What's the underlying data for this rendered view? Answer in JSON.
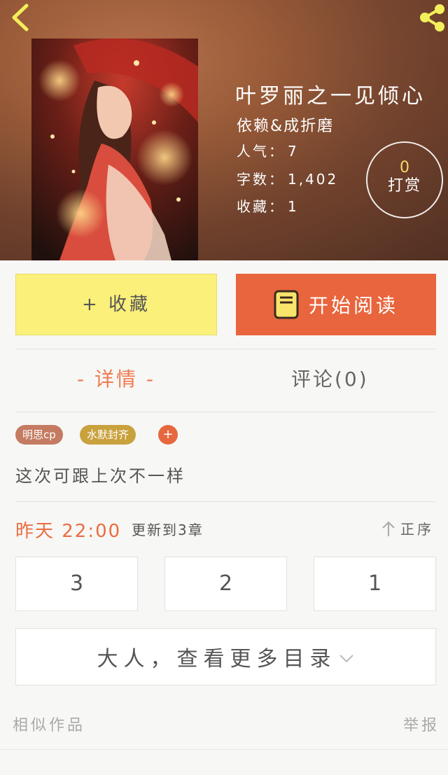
{
  "header": {
    "title": "叶罗丽之一见倾心",
    "author": "依赖&成折磨",
    "stats": [
      {
        "label": "人气：",
        "value": "7"
      },
      {
        "label": "字数：",
        "value": "1,402"
      },
      {
        "label": "收藏：",
        "value": "1"
      }
    ],
    "reward": {
      "count": "0",
      "label": "打赏"
    }
  },
  "actions": {
    "collect_label": "+ 收藏",
    "read_label": "开始阅读"
  },
  "tabs": {
    "detail": "- 详情 -",
    "comment": "评论(0)"
  },
  "tags": [
    {
      "label": "明思cp",
      "color": "#c47b61"
    },
    {
      "label": "水默封齐",
      "color": "#c9a13d"
    }
  ],
  "tag_add": "+",
  "intro": "这次可跟上次不一样",
  "update": {
    "time": "昨天 22:00",
    "text": "更新到3章",
    "sort_label": "正序"
  },
  "chapters": [
    "3",
    "2",
    "1"
  ],
  "more_label": "大人，查看更多目录",
  "footer": {
    "similar": "相似作品",
    "report": "举报"
  },
  "colors": {
    "accent": "#e8653d",
    "collect_bg": "#fbf07a",
    "reward_count": "#f6d86a"
  }
}
